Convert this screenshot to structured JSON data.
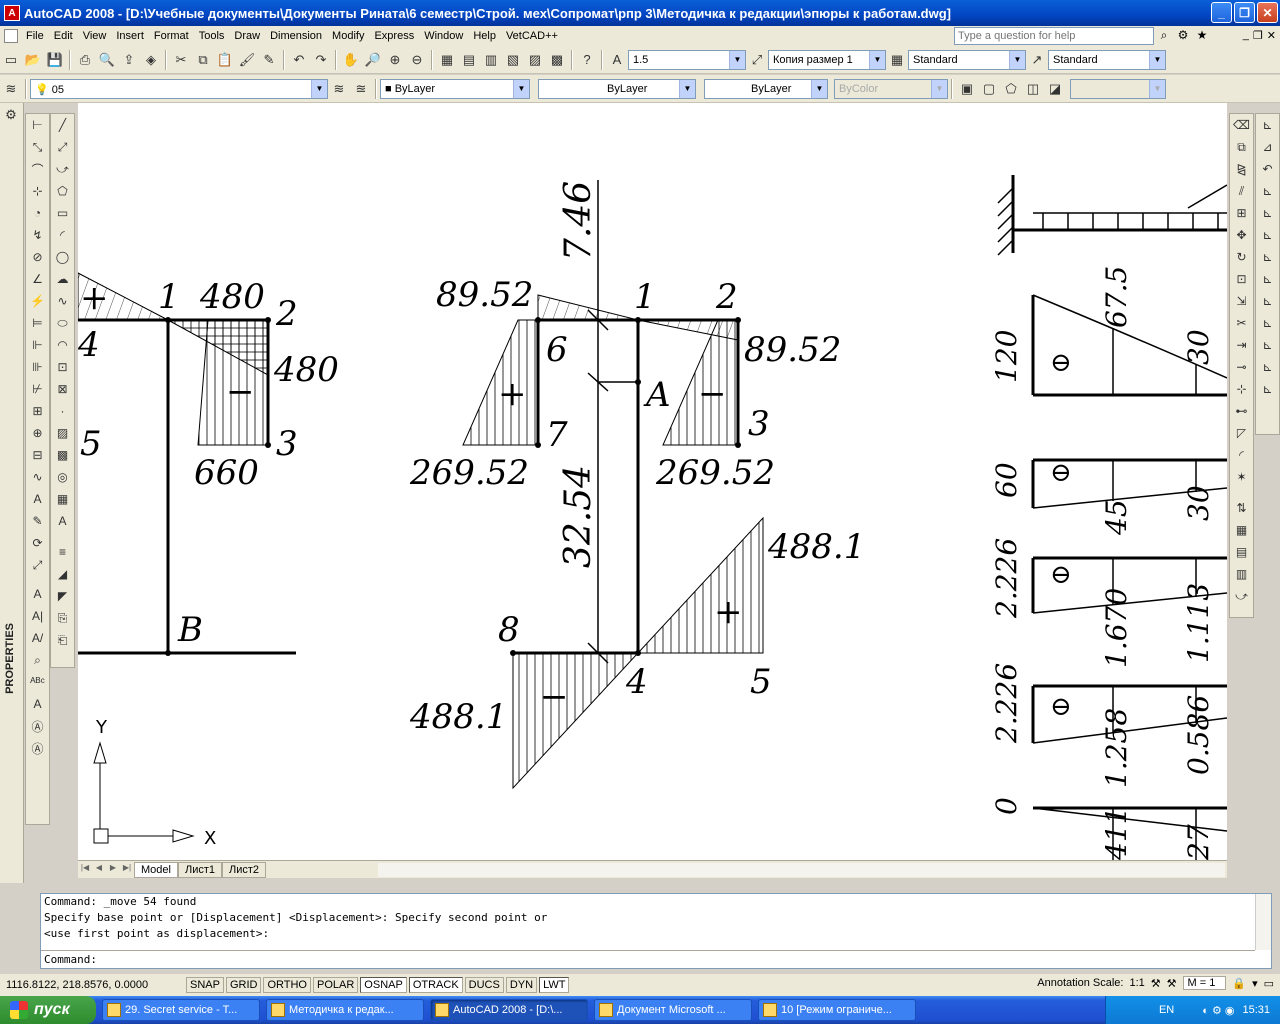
{
  "window": {
    "title": "AutoCAD 2008 - [D:\\Учебные документы\\Документы Рината\\6 семестр\\Строй. мех\\Сопромат\\рпр 3\\Методичка к редакции\\эпюры к работам.dwg]",
    "app_icon": "A"
  },
  "menu": {
    "items": [
      "File",
      "Edit",
      "View",
      "Insert",
      "Format",
      "Tools",
      "Draw",
      "Dimension",
      "Modify",
      "Express",
      "Window",
      "Help",
      "VetCAD++"
    ],
    "help_placeholder": "Type a question for help"
  },
  "toolbar1": {
    "text_height": "1.5",
    "dim_style_name": "Копия размер 1",
    "table_style": "Standard",
    "multileader_style": "Standard"
  },
  "toolbar2": {
    "layer": "05",
    "color": "ByLayer",
    "linetype": "ByLayer",
    "lineweight": "ByLayer",
    "plotstyle": "ByColor"
  },
  "left_panel": {
    "properties_label": "PROPERTIES"
  },
  "drawing": {
    "left": {
      "labels": [
        "1",
        "480",
        "2",
        "4",
        "480",
        "5",
        "3",
        "660",
        "B"
      ],
      "signs": [
        "+",
        "−"
      ]
    },
    "middle": {
      "labels": [
        "7.46",
        "89.52",
        "1",
        "2",
        "6",
        "89.52",
        "A",
        "7",
        "3",
        "269.52",
        "269.52",
        "32.54",
        "488.1",
        "8",
        "4",
        "5",
        "488.1"
      ],
      "signs": [
        "+",
        "−",
        "+",
        "−"
      ]
    },
    "right": {
      "labels": [
        "120",
        "67.5",
        "30",
        "60",
        "45",
        "30",
        "2.226",
        "1.670",
        "1.113",
        "2.226",
        "1.258",
        "0.586",
        "0",
        "411",
        "27"
      ],
      "signs": [
        "⊖",
        "⊖",
        "⊖",
        "⊖"
      ]
    },
    "ucs": {
      "x": "X",
      "y": "Y"
    }
  },
  "layout_tabs": [
    "Model",
    "Лист1",
    "Лист2"
  ],
  "command": {
    "history": [
      "Command: _move 54 found",
      "Specify base point or [Displacement] <Displacement>: Specify second point or",
      "<use first point as displacement>:"
    ],
    "prompt": "Command:"
  },
  "status": {
    "coords": "1116.8122, 218.8576, 0.0000",
    "toggles": [
      {
        "label": "SNAP",
        "on": false
      },
      {
        "label": "GRID",
        "on": false
      },
      {
        "label": "ORTHO",
        "on": false
      },
      {
        "label": "POLAR",
        "on": false
      },
      {
        "label": "OSNAP",
        "on": true
      },
      {
        "label": "OTRACK",
        "on": true
      },
      {
        "label": "DUCS",
        "on": false
      },
      {
        "label": "DYN",
        "on": false
      },
      {
        "label": "LWT",
        "on": true
      }
    ],
    "annotation_scale_label": "Annotation Scale:",
    "annotation_scale": "1:1",
    "m_value": "M = 1"
  },
  "taskbar": {
    "start": "пуск",
    "tasks": [
      "29. Secret service - T...",
      "Методичка к редак...",
      "AutoCAD 2008 - [D:\\...",
      "Документ Microsoft ...",
      "10 [Режим ограниче..."
    ],
    "active_index": 2,
    "lang": "EN",
    "clock": "15:31"
  },
  "colors": {
    "title_bar": "#0345c2",
    "canvas": "#ffffff",
    "taskbar": "#245edb",
    "start_button": "#2e8b2e"
  }
}
